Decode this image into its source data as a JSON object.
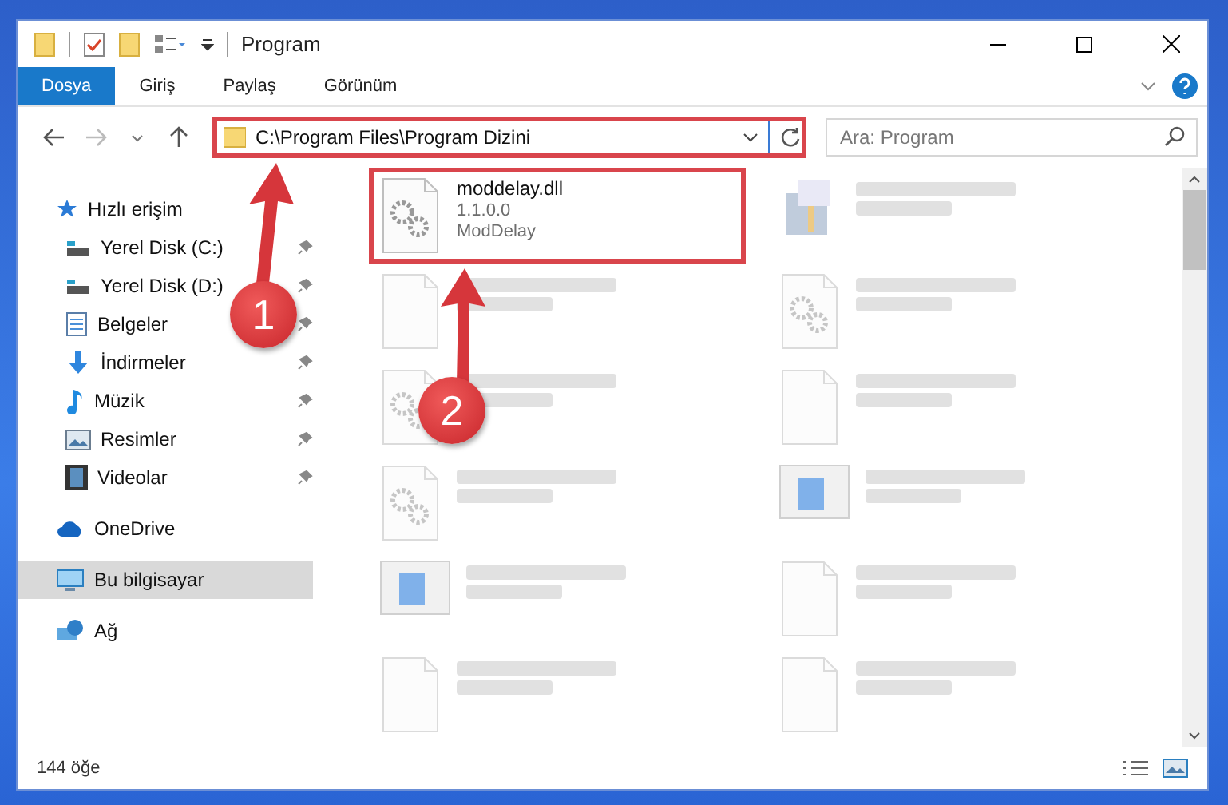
{
  "window": {
    "title": "Program"
  },
  "ribbon_tabs": [
    {
      "label": "Dosya",
      "selected": true
    },
    {
      "label": "Giriş",
      "selected": false
    },
    {
      "label": "Paylaş",
      "selected": false
    },
    {
      "label": "Görünüm",
      "selected": false
    }
  ],
  "address": {
    "path": "C:\\Program Files\\Program Dizini",
    "highlighted": true
  },
  "search": {
    "placeholder": "Ara: Program"
  },
  "sidebar": {
    "items": [
      {
        "label": "Hızlı erişim",
        "kind": "quick",
        "selected": false,
        "children": [
          {
            "label": "Yerel Disk (C:)",
            "kind": "disk",
            "pinned": true,
            "selected": false
          },
          {
            "label": "Yerel Disk (D:)",
            "kind": "disk",
            "pinned": true,
            "selected": false
          },
          {
            "label": "Belgeler",
            "kind": "docs",
            "pinned": true,
            "selected": false
          },
          {
            "label": "İndirmeler",
            "kind": "download",
            "pinned": true,
            "selected": false
          },
          {
            "label": "Müzik",
            "kind": "music",
            "pinned": true,
            "selected": false
          },
          {
            "label": "Resimler",
            "kind": "pictures",
            "pinned": true,
            "selected": false
          },
          {
            "label": "Videolar",
            "kind": "video",
            "pinned": true,
            "selected": false
          }
        ]
      },
      {
        "label": "OneDrive",
        "kind": "cloud",
        "selected": false
      },
      {
        "label": "Bu bilgisayar",
        "kind": "pc",
        "selected": true
      },
      {
        "label": "Ağ",
        "kind": "network",
        "selected": false
      }
    ]
  },
  "files": [
    {
      "name": "moddelay.dll",
      "lines": [
        "1.1.0.0",
        "ModDelay"
      ],
      "kind": "dll",
      "blurred": false,
      "highlighted": true
    },
    {
      "kind": "setup",
      "blurred": true,
      "highlighted": false
    },
    {
      "kind": "blank",
      "blurred": true,
      "highlighted": false
    },
    {
      "kind": "dll",
      "blurred": true,
      "highlighted": false
    },
    {
      "kind": "dll",
      "blurred": true,
      "highlighted": false
    },
    {
      "kind": "blank",
      "blurred": true,
      "highlighted": false
    },
    {
      "kind": "dll",
      "blurred": true,
      "highlighted": false
    },
    {
      "kind": "app",
      "blurred": true,
      "highlighted": false
    },
    {
      "kind": "app",
      "blurred": true,
      "highlighted": false
    },
    {
      "kind": "blank",
      "blurred": true,
      "highlighted": false
    },
    {
      "kind": "blank",
      "blurred": true,
      "highlighted": false
    },
    {
      "kind": "blank",
      "blurred": true,
      "highlighted": false
    }
  ],
  "status_bar": {
    "count": "144 öğe"
  },
  "annotations": [
    {
      "label": "1"
    },
    {
      "label": "2"
    }
  ]
}
